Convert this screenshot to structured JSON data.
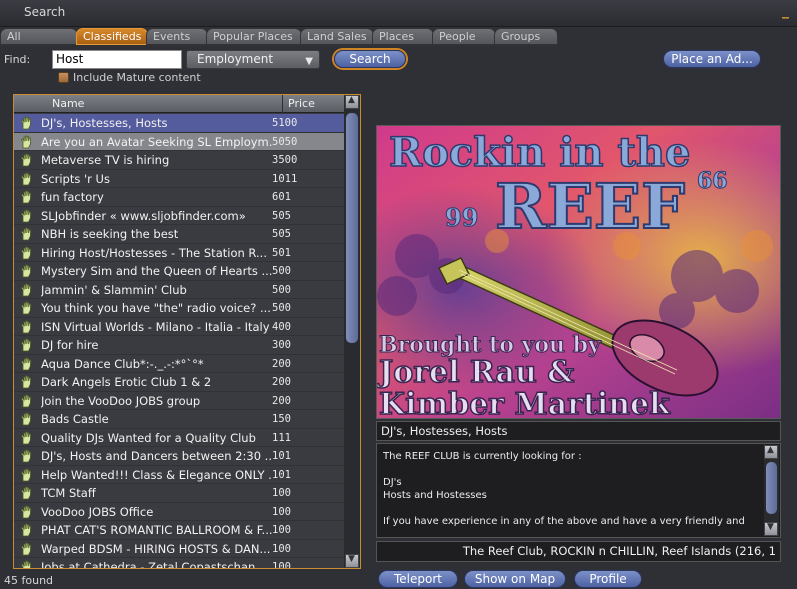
{
  "window": {
    "title": "Search",
    "minimize_label": "_"
  },
  "tabs": [
    {
      "label": "All"
    },
    {
      "label": "Classifieds",
      "active": true
    },
    {
      "label": "Events"
    },
    {
      "label": "Popular Places"
    },
    {
      "label": "Land Sales"
    },
    {
      "label": "Places"
    },
    {
      "label": "People"
    },
    {
      "label": "Groups"
    }
  ],
  "find": {
    "label": "Find:",
    "value": "Host",
    "category": "Employment",
    "search_button": "Search",
    "place_ad_button": "Place an Ad...",
    "mature_label": "Include Mature content",
    "mature_checked": false
  },
  "list": {
    "columns": {
      "name": "Name",
      "price": "Price"
    },
    "rows": [
      {
        "name": "DJ's, Hostesses, Hosts",
        "price": "5100",
        "state": "sel"
      },
      {
        "name": "Are you an Avatar Seeking SL Employm...",
        "price": "5050",
        "state": "hl"
      },
      {
        "name": "Metaverse TV is hiring",
        "price": "3500"
      },
      {
        "name": "Scripts 'r Us",
        "price": "1011"
      },
      {
        "name": "fun factory",
        "price": "601"
      },
      {
        "name": "SLJobfinder « www.sljobfinder.com»",
        "price": "505"
      },
      {
        "name": "NBH is seeking the best",
        "price": "505"
      },
      {
        "name": "Hiring Host/Hostesses - The Station R...",
        "price": "501"
      },
      {
        "name": "Mystery Sim and the Queen of Hearts ...",
        "price": "500"
      },
      {
        "name": "Jammin' & Slammin' Club",
        "price": "500"
      },
      {
        "name": "You think you have \"the\" radio voice? ...",
        "price": "500"
      },
      {
        "name": "ISN Virtual Worlds - Milano - Italia - Italy",
        "price": "400"
      },
      {
        "name": "DJ for hire",
        "price": "300"
      },
      {
        "name": "Aqua Dance Club*:-._.-:*°`°*",
        "price": "200"
      },
      {
        "name": "Dark Angels Erotic Club 1 & 2",
        "price": "200"
      },
      {
        "name": "Join the VooDoo JOBS group",
        "price": "200"
      },
      {
        "name": "Bads Castle",
        "price": "150"
      },
      {
        "name": "Quality DJs Wanted for a Quality Club",
        "price": "111"
      },
      {
        "name": "DJ's, Hosts and Dancers between 2:30 ...",
        "price": "101"
      },
      {
        "name": "Help Wanted!!! Class & Elegance ONLY ...",
        "price": "101"
      },
      {
        "name": "TCM Staff",
        "price": "100"
      },
      {
        "name": "VooDoo JOBS Office",
        "price": "100"
      },
      {
        "name": "PHAT CAT'S ROMANTIC  BALLROOM & F...",
        "price": "100"
      },
      {
        "name": "Warped BDSM - HIRING HOSTS & DAN...",
        "price": "100"
      },
      {
        "name": "Jobs at Cathedra - Zetal Copastschan...",
        "price": "100"
      }
    ],
    "row_icon": "hand-icon",
    "status": "45 found"
  },
  "detail": {
    "image": {
      "line1": "Rockin in the",
      "line2a": "99",
      "line2b": "REEF",
      "line2c": "66",
      "line3": "Brought to you by",
      "line4": "Jorel Rau &",
      "line5": "Kimber Martinek"
    },
    "name": "DJ's, Hostesses, Hosts",
    "description": "The REEF CLUB is currently looking for :\n\nDJ's\nHosts and Hostesses\n\nIf you have experience in any of the above and have a very friendly and",
    "location": "The Reef Club, ROCKIN n CHILLIN, Reef Islands (216, 1",
    "buttons": {
      "teleport": "Teleport",
      "show_on_map": "Show on Map",
      "profile": "Profile"
    }
  },
  "colors": {
    "accent_orange": "#d08524",
    "selection_blue": "#545c9e",
    "button_blue": "#5f74b4",
    "background": "#2f3035"
  }
}
